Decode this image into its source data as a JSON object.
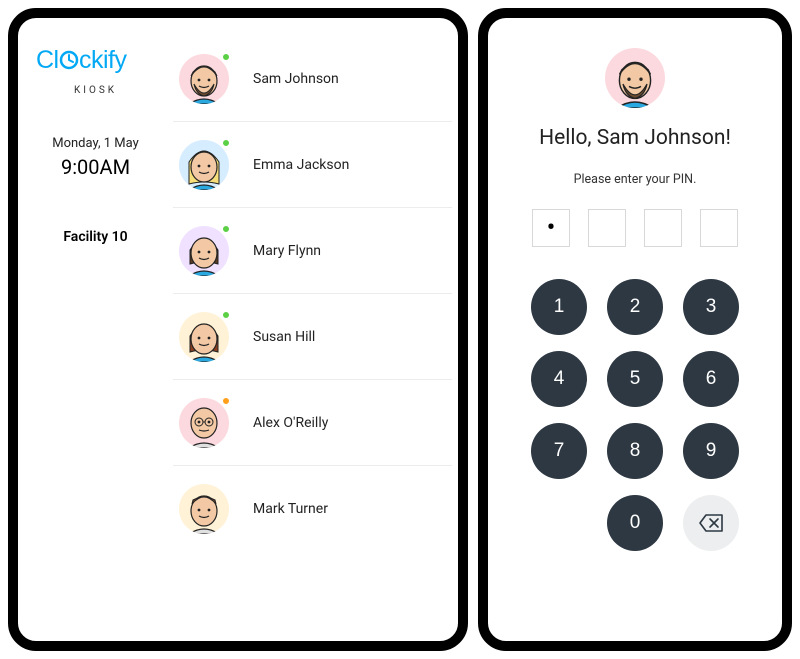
{
  "brand": {
    "name": "Clockify",
    "sub": "KIOSK"
  },
  "clock": {
    "date": "Monday, 1 May",
    "time": "9:00AM"
  },
  "facility": "Facility 10",
  "employees": [
    {
      "name": "Sam Johnson",
      "status": "green",
      "avatar_bg": "#fcd9de",
      "face": "beard-brown"
    },
    {
      "name": "Emma Jackson",
      "status": "green",
      "avatar_bg": "#d6ecff",
      "face": "blonde-long"
    },
    {
      "name": "Mary Flynn",
      "status": "green",
      "avatar_bg": "#efe1ff",
      "face": "brunette-bob"
    },
    {
      "name": "Susan Hill",
      "status": "green",
      "avatar_bg": "#fff2d6",
      "face": "redhead"
    },
    {
      "name": "Alex O'Reilly",
      "status": "orange",
      "avatar_bg": "#fcd9de",
      "face": "bald"
    },
    {
      "name": "Mark Turner",
      "status": "none",
      "avatar_bg": "#fff2d6",
      "face": "short-brown"
    }
  ],
  "pin": {
    "selected_name": "Sam Johnson",
    "selected_avatar_bg": "#fcd9de",
    "selected_face": "beard-brown",
    "greeting_prefix": "Hello, ",
    "greeting_suffix": "!",
    "prompt": "Please enter your PIN.",
    "digits_entered": 1,
    "digits_total": 4
  },
  "keypad": [
    "1",
    "2",
    "3",
    "4",
    "5",
    "6",
    "7",
    "8",
    "9",
    "",
    "0",
    "back"
  ]
}
